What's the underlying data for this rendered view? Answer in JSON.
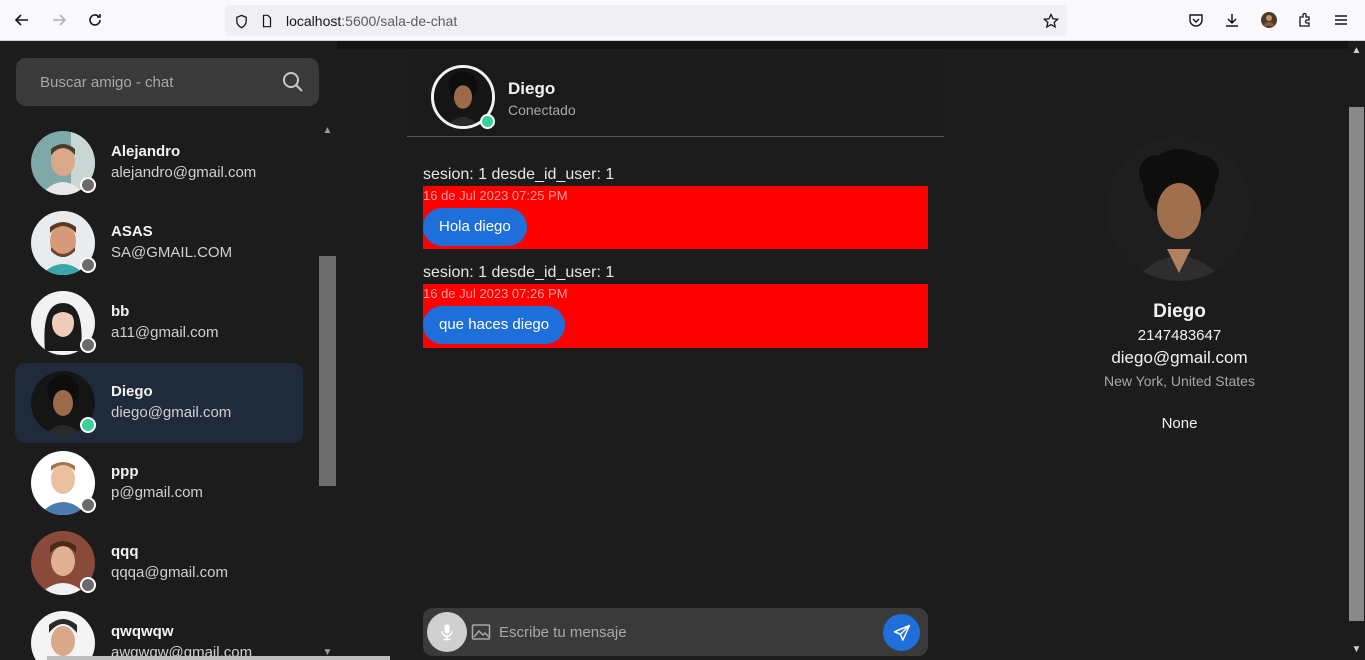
{
  "browser": {
    "url_host": "localhost",
    "url_path": ":5600/sala-de-chat"
  },
  "sidebar": {
    "search_placeholder": "Buscar amigo - chat",
    "contacts": [
      {
        "name": "Alejandro",
        "email": "alejandro@gmail.com",
        "status": "offline",
        "active": false
      },
      {
        "name": "ASAS",
        "email": "SA@GMAIL.COM",
        "status": "offline",
        "active": false
      },
      {
        "name": "bb",
        "email": "a11@gmail.com",
        "status": "offline",
        "active": false
      },
      {
        "name": "Diego",
        "email": "diego@gmail.com",
        "status": "online",
        "active": true
      },
      {
        "name": "ppp",
        "email": "p@gmail.com",
        "status": "offline",
        "active": false
      },
      {
        "name": "qqq",
        "email": "qqqa@gmail.com",
        "status": "offline",
        "active": false
      },
      {
        "name": "qwqwqw",
        "email": "awqwqw@gmail.com",
        "status": "offline",
        "active": false
      }
    ]
  },
  "chat": {
    "header_name": "Diego",
    "header_status": "Conectado",
    "messages": [
      {
        "meta": "sesion: 1 desde_id_user: 1",
        "time": "16 de Jul 2023 07:25 PM",
        "text": "Hola diego"
      },
      {
        "meta": "sesion: 1 desde_id_user: 1",
        "time": "16 de Jul 2023 07:26 PM",
        "text": "que haces diego"
      }
    ],
    "input_placeholder": "Escribe tu mensaje"
  },
  "profile": {
    "name": "Diego",
    "phone": "2147483647",
    "email": "diego@gmail.com",
    "location": "New York, United States",
    "bio": "None"
  },
  "colors": {
    "online": "#34d399",
    "offline": "#6b6b6b",
    "accent": "#1e6fd9",
    "message_bg": "#ff0000"
  }
}
